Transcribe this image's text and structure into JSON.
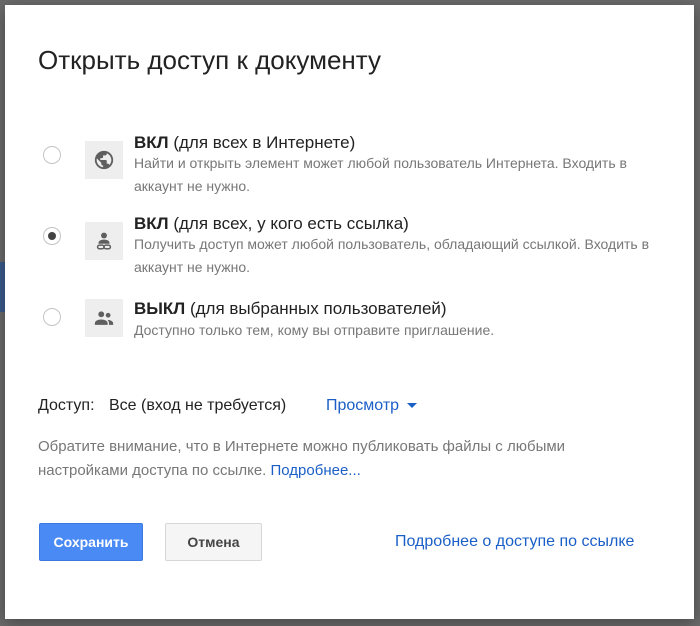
{
  "dialog": {
    "title": "Открыть доступ к документу",
    "options": [
      {
        "title_bold": "ВКЛ",
        "title_rest": " (для всех в Интернете)",
        "description": "Найти и открыть элемент может любой пользователь Интернета. Входить в аккаунт не нужно.",
        "icon": "globe-icon",
        "checked": false
      },
      {
        "title_bold": "ВКЛ",
        "title_rest": " (для всех, у кого есть ссылка)",
        "description": "Получить доступ может любой пользователь, обладающий ссылкой. Входить в аккаунт не нужно.",
        "icon": "person-link-icon",
        "checked": true
      },
      {
        "title_bold": "ВЫКЛ",
        "title_rest": " (для выбранных пользователей)",
        "description": "Доступно только тем, кому вы отправите приглашение.",
        "icon": "people-icon",
        "checked": false
      }
    ],
    "access": {
      "label": "Доступ:",
      "value": "Все (вход не требуется)",
      "dropdown_selected": "Просмотр"
    },
    "note": {
      "text": "Обратите внимание, что в Интернете можно публиковать файлы с любыми настройками доступа по ссылке. ",
      "link": "Подробнее..."
    },
    "buttons": {
      "save": "Сохранить",
      "cancel": "Отмена"
    },
    "more_link": "Подробнее о доступе по ссылке"
  },
  "colors": {
    "link": "#1a5fc7",
    "primary_button": "#4a8af4",
    "overlay": "#6b6b6b"
  }
}
